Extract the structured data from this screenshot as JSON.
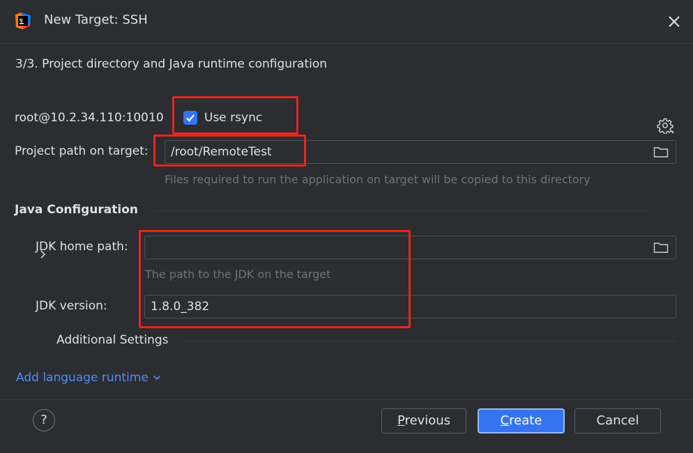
{
  "window": {
    "title": "New Target: SSH",
    "step": "3/3. Project directory and Java runtime configuration"
  },
  "connection": {
    "host": "root@10.2.34.110:10010",
    "rsync_label": "Use rsync",
    "rsync_checked": true
  },
  "project_path": {
    "label": "Project path on target:",
    "value": "/root/RemoteTest",
    "hint": "Files required to run the application on target will be copied to this directory"
  },
  "java": {
    "section_title": "Java Configuration",
    "jdk_home_label": "JDK home path:",
    "jdk_home_value": "",
    "jdk_home_hint": "The path to the JDK on the target",
    "jdk_version_label": "JDK version:",
    "jdk_version_value": "1.8.0_382",
    "additional_settings": "Additional Settings"
  },
  "add_runtime_link": "Add language runtime",
  "footer": {
    "help": "?",
    "previous_mnemonic": "P",
    "previous_rest": "revious",
    "create_mnemonic": "C",
    "create_rest": "reate",
    "cancel": "Cancel"
  },
  "colors": {
    "background": "#2b2d30",
    "accent": "#3574f0",
    "link": "#548af7",
    "highlight": "#e8261d"
  }
}
